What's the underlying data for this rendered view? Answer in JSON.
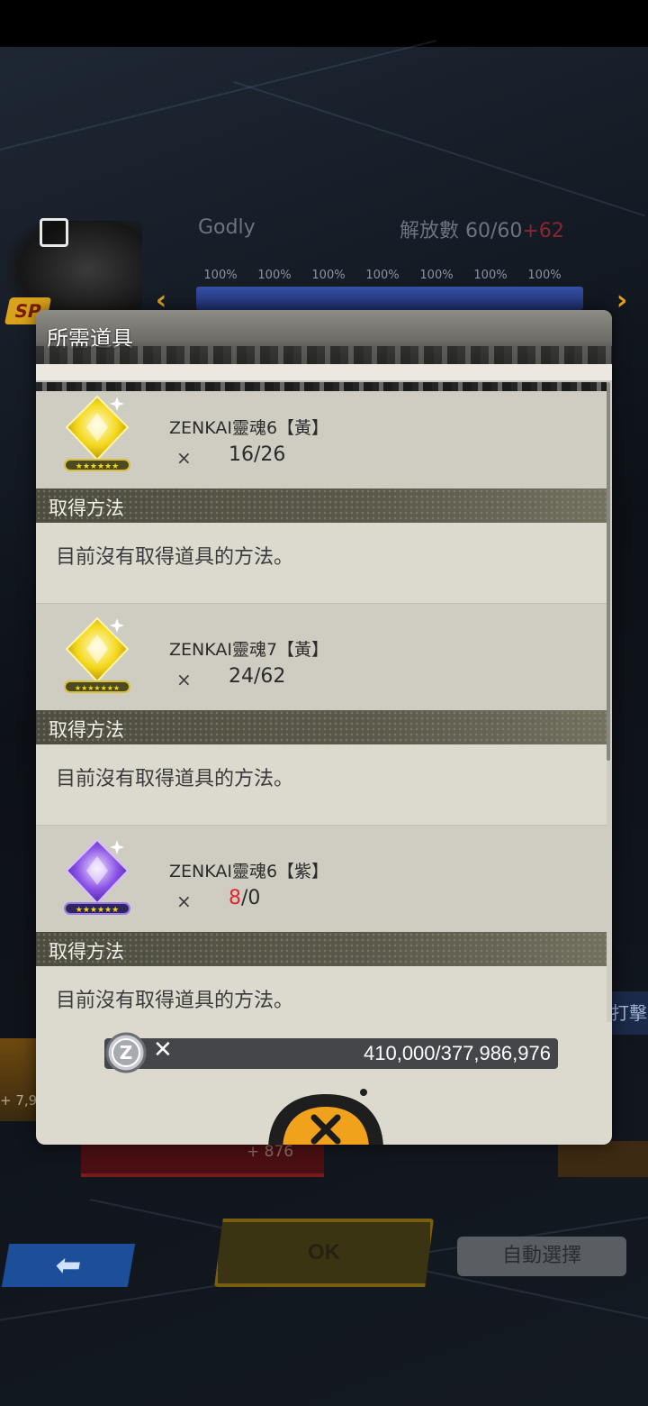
{
  "background": {
    "rank_name": "Godly",
    "release_label": "解放數 60/60",
    "release_bonus": "+62",
    "sp_badge": "SP",
    "tier_progress": [
      "100%",
      "100%",
      "100%",
      "100%",
      "100%",
      "100%",
      "100%"
    ],
    "side_tab_text": "打擊",
    "left_strip_text": "+ 7,9",
    "panel_stat": "+ 876",
    "ok_label": "OK",
    "auto_select_label": "自動選擇"
  },
  "modal": {
    "title": "所需道具",
    "items": [
      {
        "name": "ZENKAI靈魂6【黃】",
        "times": "×",
        "count_have": "16",
        "count_rest": "/26",
        "method_label": "取得方法",
        "method_text": "目前沒有取得道具的方法。",
        "icon": "yellow-soul-crystal-icon",
        "color": "#f2d41c"
      },
      {
        "name": "ZENKAI靈魂7【黃】",
        "times": "×",
        "count_have": "24",
        "count_rest": "/62",
        "method_label": "取得方法",
        "method_text": "目前沒有取得道具的方法。",
        "icon": "yellow-soul-crystal-icon",
        "color": "#f2d41c"
      },
      {
        "name": "ZENKAI靈魂6【紫】",
        "times": "×",
        "count_have": "8",
        "count_rest": "/0",
        "method_label": "取得方法",
        "method_text": "目前沒有取得道具的方法。",
        "icon": "purple-soul-crystal-icon",
        "color": "#8a52e6"
      }
    ],
    "cost": {
      "icon": "zeni-coin-icon",
      "times": "✕",
      "required": "410,000",
      "owned": "/377,986,976"
    },
    "close_icon": "close-x-icon",
    "accent_color": "#f0a21c",
    "short_color": "#e0262e"
  }
}
